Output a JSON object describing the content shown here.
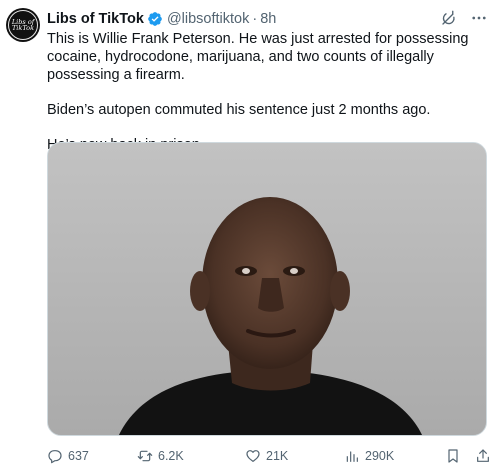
{
  "author": {
    "name": "Libs of TikTok",
    "handle": "@libsoftiktok",
    "separator": "·",
    "time": "8h",
    "avatar_text_line1": "Libs of",
    "avatar_text_line2": "TikTok",
    "verified_color": "#1d9bf0"
  },
  "tweet": {
    "paragraphs": [
      "This is Willie Frank Peterson. He was just arrested for possessing cocaine, hydrocodone, marijuana, and two counts of illegally possessing a firearm.",
      "Biden’s autopen commuted his sentence just 2 months ago.",
      "He’s now back in prison."
    ]
  },
  "media": {
    "description_icon": "photo"
  },
  "stats": {
    "replies": "637",
    "reposts": "6.2K",
    "likes": "21K",
    "views": "290K"
  },
  "icons": {
    "grok": "grok-icon",
    "more": "more-icon",
    "reply": "reply-icon",
    "repost": "repost-icon",
    "like": "heart-icon",
    "views": "views-icon",
    "bookmark": "bookmark-icon",
    "share": "share-icon"
  },
  "colors": {
    "text": "#0f1419",
    "secondary": "#536471",
    "border": "#cfd9de"
  }
}
